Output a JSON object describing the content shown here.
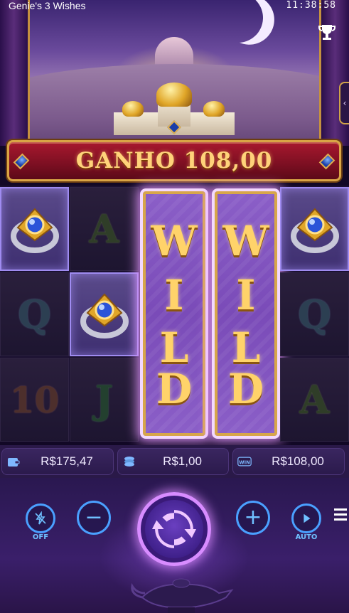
{
  "status_bar": {
    "title": "Genie's 3 Wishes",
    "time": "11:38:58"
  },
  "win_banner": {
    "text": "GANHO 108,00"
  },
  "reels": {
    "columns": [
      [
        "ring",
        "Q",
        "10"
      ],
      [
        "A",
        "ring",
        "J"
      ],
      [
        "WILD",
        "WILD",
        "WILD"
      ],
      [
        "WILD",
        "WILD",
        "WILD"
      ],
      [
        "ring",
        "Q",
        "A"
      ]
    ],
    "wild_letters": [
      "W",
      "I",
      "L",
      "D"
    ],
    "symbols": {
      "a": "A",
      "q": "Q",
      "ten": "10",
      "j": "J"
    }
  },
  "stats": {
    "balance": "R$175,47",
    "bet": "R$1,00",
    "win": "R$108,00",
    "win_badge": "WIN"
  },
  "controls": {
    "turbo_label": "OFF",
    "auto_label": "AUTO",
    "minus_label": "−",
    "plus_label": "+"
  },
  "colors": {
    "accent_blue": "#4aa0ff",
    "gold": "#ffd27a",
    "banner_red": "#a8182e",
    "wild_purple": "#8b5fc8"
  },
  "icons": [
    "trophy-icon",
    "chevron-left-icon",
    "wallet-icon",
    "coins-icon",
    "win-icon",
    "lightning-off-icon",
    "minus-icon",
    "spin-arrows-icon",
    "plus-icon",
    "play-auto-icon",
    "hamburger-menu-icon",
    "magic-lamp-icon"
  ]
}
